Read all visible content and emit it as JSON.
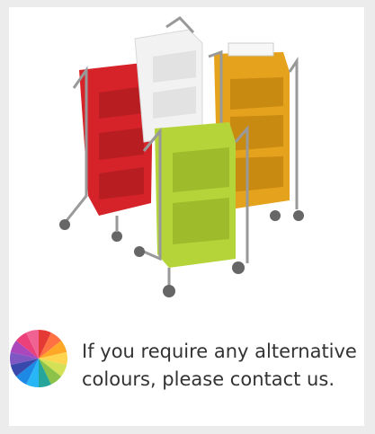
{
  "note": {
    "line1": "If you require any alternative",
    "line2": "colours, please contact us."
  },
  "product_image": {
    "description_icon": "colour-book-trolleys-image",
    "trolley_colors": [
      "#d6232a",
      "#f2f2f2",
      "#e5a21c",
      "#b5d43a"
    ],
    "frame_color": "#9a9a9a"
  },
  "swatch": {
    "icon": "colour-wheel-icon",
    "colors": [
      "#e53935",
      "#ff7043",
      "#ffa726",
      "#ffd54f",
      "#d4e157",
      "#8bc34a",
      "#26a69a",
      "#29b6f6",
      "#1e88e5",
      "#3949ab",
      "#7e57c2",
      "#ab47bc",
      "#ec407a",
      "#f06292"
    ]
  }
}
